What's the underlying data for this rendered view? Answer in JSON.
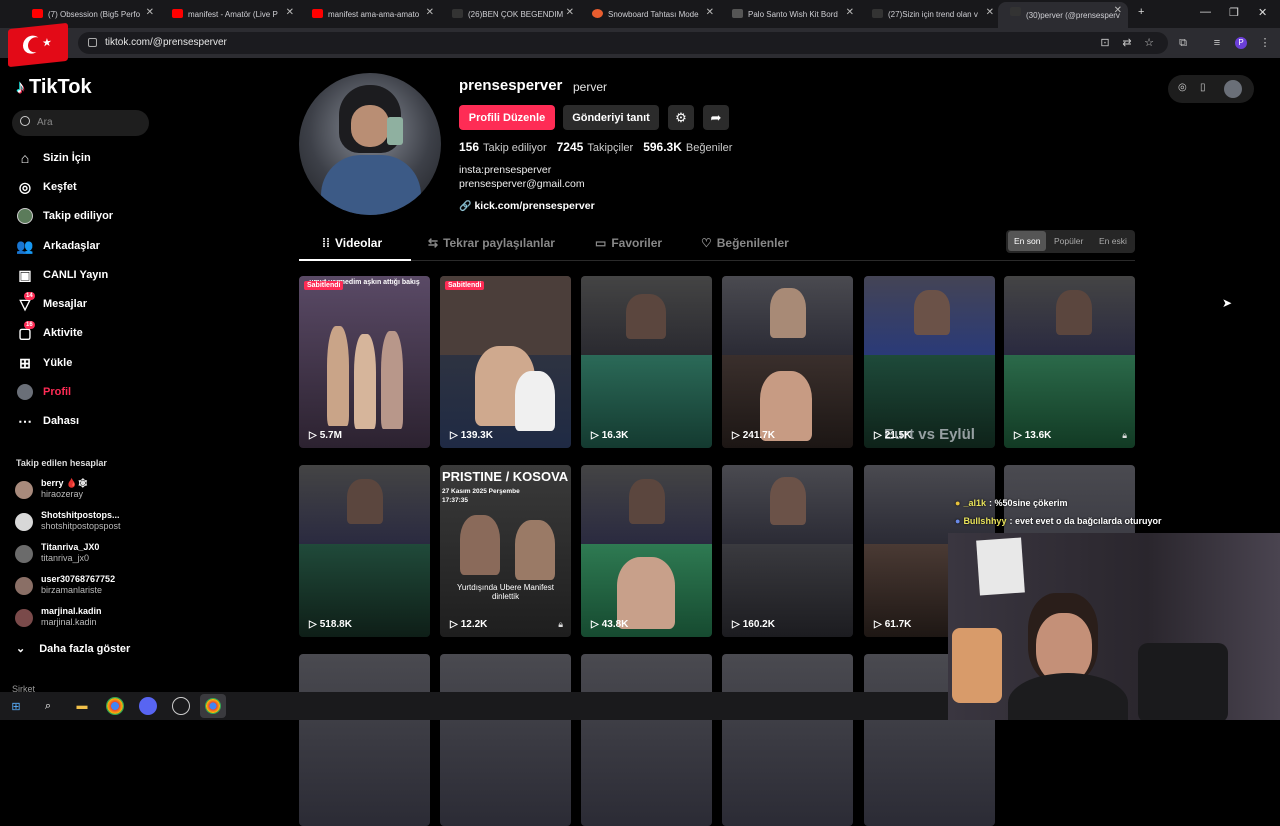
{
  "browser": {
    "tabs": [
      {
        "title": "(7) Obsession (Big5 Perfo",
        "favicon_color": "#ff0000"
      },
      {
        "title": "manifest - Amatör (Live P",
        "favicon_color": "#ff0000"
      },
      {
        "title": "manifest ama-ama-amato",
        "favicon_color": "#ff0000"
      },
      {
        "title": "(26)BEN ÇOK BEGENDIM",
        "favicon_color": "#000000"
      },
      {
        "title": "Snowboard Tahtası Mode",
        "favicon_color": "#e85d2f"
      },
      {
        "title": "Palo Santo Wish Kit Bord",
        "favicon_color": "#444444"
      },
      {
        "title": "(27)Sizin için trend olan v",
        "favicon_color": "#000000"
      },
      {
        "title": "(30)perver (@prensesperv",
        "favicon_color": "#000000"
      }
    ],
    "url": "tiktok.com/@prensesperver"
  },
  "tiktok": {
    "logo_text": "TikTok",
    "search_placeholder": "Ara",
    "accent_color": "#fe2c55",
    "nav": [
      {
        "label": "Sizin İçin",
        "icon": "home-icon"
      },
      {
        "label": "Keşfet",
        "icon": "compass-icon"
      },
      {
        "label": "Takip ediliyor",
        "icon": "following-icon"
      },
      {
        "label": "Arkadaşlar",
        "icon": "friends-icon"
      },
      {
        "label": "CANLI Yayın",
        "icon": "live-icon"
      },
      {
        "label": "Mesajlar",
        "icon": "send-icon",
        "badge": "14"
      },
      {
        "label": "Aktivite",
        "icon": "inbox-icon",
        "badge": "16"
      },
      {
        "label": "Yükle",
        "icon": "upload-icon"
      },
      {
        "label": "Profil",
        "icon": "avatar-icon"
      },
      {
        "label": "Dahası",
        "icon": "more-icon"
      }
    ],
    "following_section_title": "Takip edilen hesaplar",
    "following": [
      {
        "name": "berry 🩸🕸",
        "handle": "hiraozeray"
      },
      {
        "name": "Shotshitpostops...",
        "handle": "shotshitpostopspost"
      },
      {
        "name": "Titanriva_JX0",
        "handle": "titanriva_jx0"
      },
      {
        "name": "user30768767752",
        "handle": "birzamanlariste"
      },
      {
        "name": "marjinal.kadin",
        "handle": "marjinal.kadin"
      }
    ],
    "show_more_label": "Daha fazla göster",
    "company_label": "Şirket"
  },
  "profile": {
    "username": "prensesperver",
    "nickname": "perver",
    "edit_button": "Profili Düzenle",
    "promote_button": "Gönderiyi tanıt",
    "stats": [
      {
        "value": "156",
        "label": "Takip ediliyor"
      },
      {
        "value": "7245",
        "label": "Takipçiler"
      },
      {
        "value": "596.3K",
        "label": "Beğeniler"
      }
    ],
    "bio_lines": [
      "insta:prensesperver",
      "prensesperver@gmail.com"
    ],
    "link": "kick.com/prensesperver",
    "tabs": [
      {
        "label": "Videolar",
        "icon": "grid-icon"
      },
      {
        "label": "Tekrar paylaşılanlar",
        "icon": "repost-icon"
      },
      {
        "label": "Favoriler",
        "icon": "bookmark-icon"
      },
      {
        "label": "Beğenilenler",
        "icon": "heart-icon"
      }
    ],
    "sort_options": [
      "En son",
      "Popüler",
      "En eski"
    ],
    "selected_sort": "En son"
  },
  "videos": [
    {
      "views": "5.7M",
      "pinned": "Sabitlendi",
      "caption_top": "umut vermedim aşkın attığı bakış"
    },
    {
      "views": "139.3K",
      "pinned": "Sabitlendi"
    },
    {
      "views": "16.3K"
    },
    {
      "views": "241.7K"
    },
    {
      "views": "21.5K",
      "overlay": "Eurt vs Eylül"
    },
    {
      "views": "13.6K",
      "locked": true
    },
    {
      "views": "518.8K"
    },
    {
      "views": "12.2K",
      "locked": true,
      "headline": "PRISTINE / KOSOVA",
      "date": "27 Kasım 2025 Perşembe",
      "time": "17:37:35",
      "subtitle": "Yurtdışında Ubere Manifest dinlettik"
    },
    {
      "views": "43.8K"
    },
    {
      "views": "160.2K"
    },
    {
      "views": "61.7K"
    },
    {
      "views": ""
    }
  ],
  "chat": [
    {
      "user": "_al1k",
      "message": ": %50sine çökerim"
    },
    {
      "user": "Bullshhyy",
      "message": ": evet evet o da bağcılarda oturuyor"
    }
  ]
}
